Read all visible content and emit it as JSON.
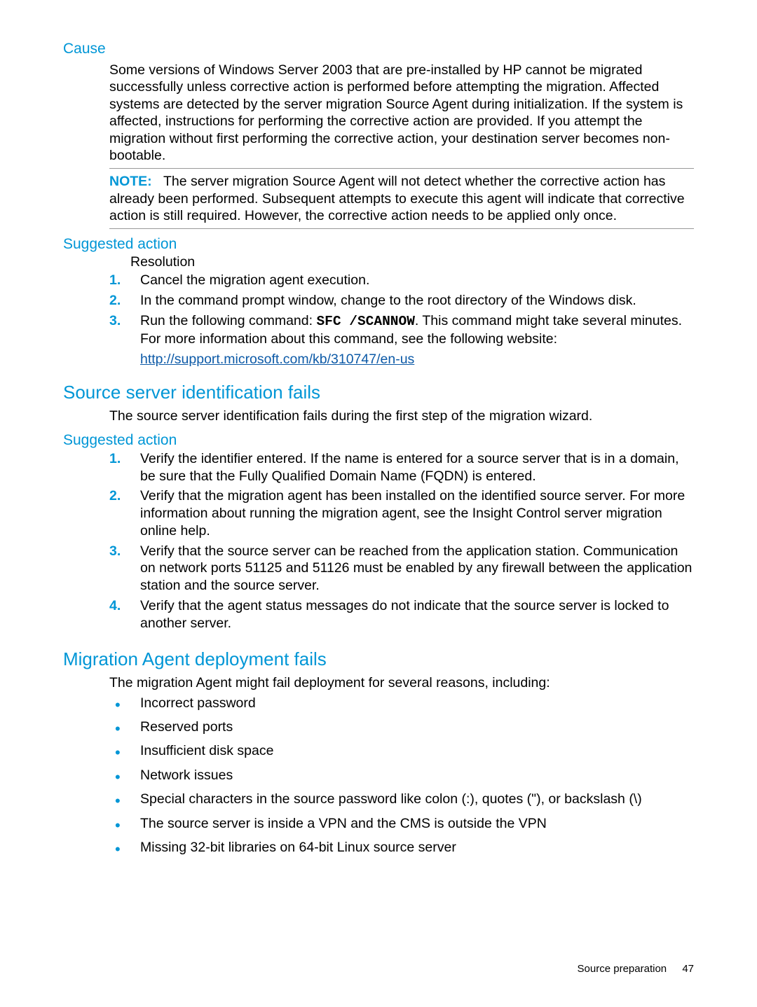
{
  "sections": {
    "cause": {
      "heading": "Cause",
      "body": "Some versions of Windows Server 2003 that are pre-installed by HP cannot be migrated successfully unless corrective action is performed before attempting the migration. Affected systems are detected by the server migration Source Agent during initialization. If the system is affected, instructions for performing the corrective action are provided. If you attempt the migration without first performing the corrective action, your destination server becomes non-bootable.",
      "note_label": "NOTE:",
      "note_body": "The server migration Source Agent will not detect whether the corrective action has already been performed. Subsequent attempts to execute this agent will indicate that corrective action is still required. However, the corrective action needs to be applied only once."
    },
    "suggested1": {
      "heading": "Suggested action",
      "resolution_label": "Resolution",
      "steps": [
        "Cancel the migration agent execution.",
        "In the command prompt window, change to the root directory of the Windows disk."
      ],
      "step3_before": "Run the following command: ",
      "step3_code": "SFC /SCANNOW",
      "step3_after": ". This command might take several minutes. For more information about this command, see the following website:",
      "link": "http://support.microsoft.com/kb/310747/en-us"
    },
    "source_id": {
      "heading": "Source server identification fails",
      "intro": "The source server identification fails during the first step of the migration wizard."
    },
    "suggested2": {
      "heading": "Suggested action",
      "steps": [
        "Verify the identifier entered. If the name is entered for a source server that is in a domain, be sure that the Fully Qualified Domain Name (FQDN) is entered.",
        "Verify that the migration agent has been installed on the identified source server. For more information about running the migration agent, see the Insight Control server migration online help.",
        "Verify that the source server can be reached from the application station. Communication on network ports 51125 and 51126 must be enabled by any firewall between the application station and the source server.",
        "Verify that the agent status messages do not indicate that the source server is locked to another server."
      ]
    },
    "deploy": {
      "heading": "Migration Agent deployment fails",
      "intro": "The migration Agent might fail deployment for several reasons, including:",
      "bullets": [
        "Incorrect password",
        "Reserved ports",
        "Insufficient disk space",
        "Network issues",
        "Special characters in the source password like colon (:), quotes (\"), or backslash (\\)",
        "The source server is inside a VPN and the CMS is outside the VPN",
        "Missing 32-bit libraries on 64-bit Linux source server"
      ]
    }
  },
  "footer": {
    "section": "Source preparation",
    "page": "47"
  }
}
